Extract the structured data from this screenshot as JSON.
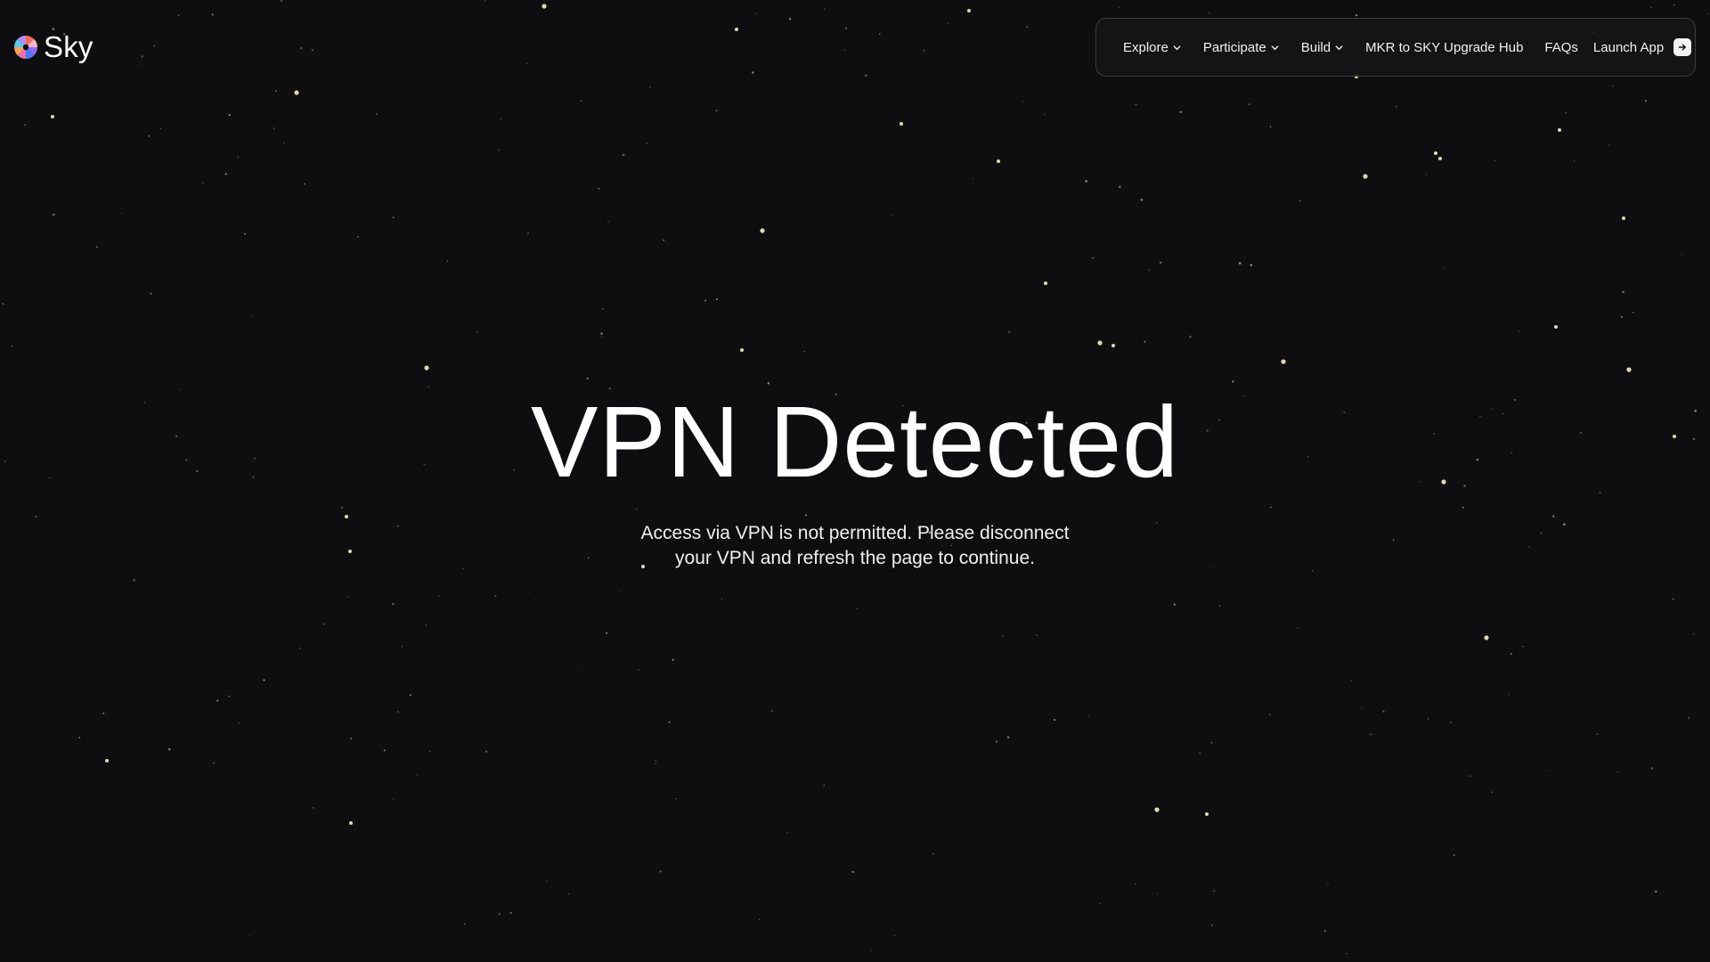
{
  "brand": {
    "name": "Sky",
    "logo_icon": "sky-pinwheel-logo-icon"
  },
  "nav": {
    "items": [
      {
        "label": "Explore",
        "has_dropdown": true
      },
      {
        "label": "Participate",
        "has_dropdown": true
      },
      {
        "label": "Build",
        "has_dropdown": true
      },
      {
        "label": "MKR to SKY Upgrade Hub",
        "has_dropdown": false
      },
      {
        "label": "FAQs",
        "has_dropdown": false
      }
    ],
    "launch_label": "Launch App",
    "launch_icon": "arrow-right-icon"
  },
  "hero": {
    "title": "VPN Detected",
    "subtitle": "Access via VPN is not permitted. Please disconnect your VPN and refresh the page to continue."
  },
  "colors": {
    "background": "#0e0e10",
    "text": "#ffffff",
    "nav_border": "#3a3a3e",
    "star": "#f6f1c8"
  }
}
